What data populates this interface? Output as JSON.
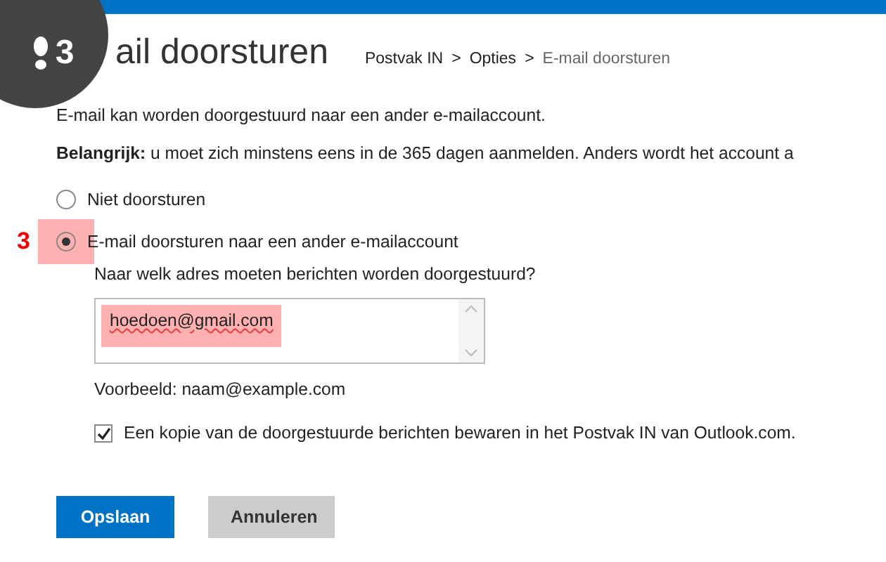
{
  "step_badge": {
    "number": "3"
  },
  "title": "ail doorsturen",
  "breadcrumb": [
    {
      "label": "Postvak IN",
      "kind": "link"
    },
    {
      "label": ">",
      "kind": "sep"
    },
    {
      "label": "Opties",
      "kind": "link"
    },
    {
      "label": ">",
      "kind": "sep"
    },
    {
      "label": "E-mail doorsturen",
      "kind": "current"
    }
  ],
  "intro": "E-mail kan worden doorgestuurd naar een ander e-mailaccount.",
  "notice": "**Belangrijk:** u moet zich minstens eens in de 365 dagen aanmelden. Anders wordt het account a",
  "options": [
    {
      "label": "Niet doorsturen",
      "selected": false
    },
    {
      "label": "E-mail doorsturen naar een ander e-mailaccount",
      "selected": true,
      "marker": "3"
    }
  ],
  "address": {
    "label": "Naar welk adres moeten berichten worden doorgestuurd?",
    "value": "hoedoen@gmail.com",
    "highlighted": true
  },
  "example": "Voorbeeld: naam@example.com",
  "keep_copy": {
    "label": "Een kopie van de doorgestuurde berichten bewaren in het Postvak IN van Outlook.com.",
    "checked": true
  },
  "buttons": [
    {
      "label": "Opslaan",
      "kind": "primary"
    },
    {
      "label": "Annuleren",
      "kind": "secondary"
    }
  ]
}
